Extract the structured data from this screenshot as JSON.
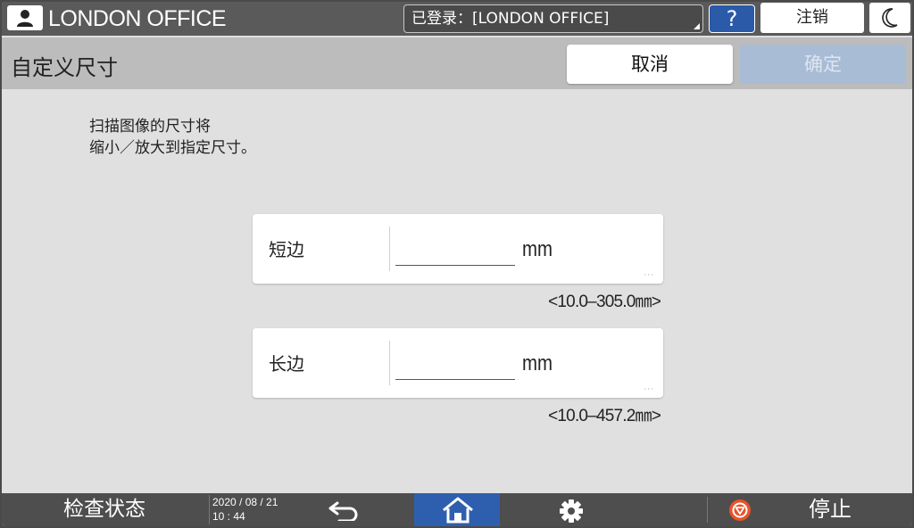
{
  "topbar": {
    "title": "LONDON OFFICE",
    "login_status": "已登录：[LONDON OFFICE]",
    "help_label": "?",
    "logout_label": "注销"
  },
  "header": {
    "page_title": "自定义尺寸",
    "cancel_label": "取消",
    "ok_label": "确定"
  },
  "main": {
    "description_line1": "扫描图像的尺寸将",
    "description_line2": "缩小／放大到指定尺寸。",
    "fields": [
      {
        "label": "短边",
        "value": "",
        "unit": "mm",
        "range": "<10.0–305.0㎜>"
      },
      {
        "label": "长边",
        "value": "",
        "unit": "mm",
        "range": "<10.0–457.2㎜>"
      }
    ]
  },
  "footer": {
    "status_label": "检查状态",
    "date": "2020 / 08 / 21",
    "time": "10 : 44",
    "stop_label": "停止"
  },
  "colors": {
    "home_accent": "#2e5fae",
    "help_accent": "#2a5aa8",
    "stop_icon": "#e8532a",
    "ok_disabled": "#a9bcd6"
  },
  "icons": [
    "user-icon",
    "moon-icon",
    "back-arrow-icon",
    "home-icon",
    "gear-icon",
    "stop-icon"
  ]
}
